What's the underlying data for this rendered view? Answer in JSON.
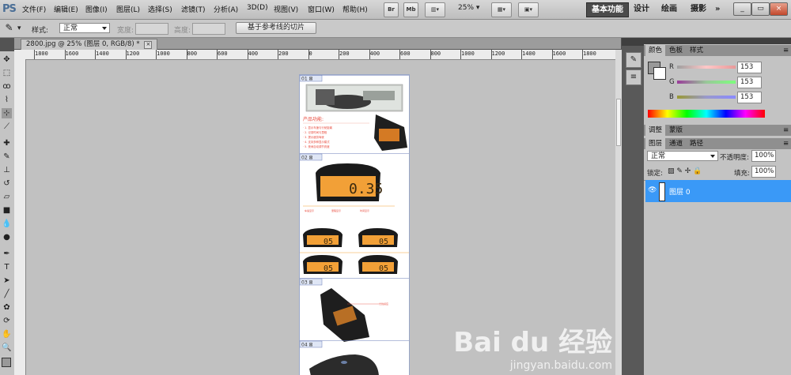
{
  "app": {
    "logo": "PS"
  },
  "menu": [
    "文件(F)",
    "编辑(E)",
    "图像(I)",
    "图层(L)",
    "选择(S)",
    "滤镜(T)",
    "分析(A)",
    "3D(D)",
    "视图(V)",
    "窗口(W)",
    "帮助(H)"
  ],
  "app_toolbar": {
    "br": "Br",
    "mb": "Mb",
    "zoom": "25%"
  },
  "workspaces": [
    "基本功能",
    "设计",
    "绘画",
    "摄影"
  ],
  "more": "»",
  "options": {
    "style_label": "样式:",
    "style_value": "正常",
    "width_label": "宽度:",
    "height_label": "高度:",
    "slice_button": "基于参考线的切片"
  },
  "document": {
    "tab_title": "2800.jpg @ 25% (图层 0, RGB/8) *",
    "close": "×"
  },
  "ruler_labels": [
    "1800",
    "1600",
    "1400",
    "1200",
    "1000",
    "800",
    "600",
    "400",
    "200",
    "0",
    "200",
    "400",
    "600",
    "800",
    "1000",
    "1200",
    "1400",
    "1600",
    "1800"
  ],
  "color_panel": {
    "tabs": [
      "颜色",
      "色板",
      "样式"
    ],
    "r_label": "R",
    "g_label": "G",
    "b_label": "B",
    "r": "153",
    "g": "153",
    "b": "153",
    "swatch": "#999999"
  },
  "adjust_tabs": [
    "调整",
    "蒙版"
  ],
  "layers_panel": {
    "tabs": [
      "图层",
      "通道",
      "路径"
    ],
    "blend_mode": "正常",
    "opacity_label": "不透明度:",
    "opacity": "100%",
    "lock_label": "锁定:",
    "fill_label": "填充:",
    "fill": "100%",
    "layer_name": "图层 0"
  },
  "colors": {
    "accent": "#3a99f7",
    "orange": "#f2a037"
  },
  "doc_content": {
    "heading": "产品功能:",
    "items": [
      "1. 显示车速与行驶距离",
      "2. 记录时间与里程",
      "3. 提示疲劳驾驶",
      "4. 支持多种显示模式"
    ],
    "displays": [
      "0.35",
      "05",
      "05",
      "05",
      "05"
    ]
  },
  "watermark": {
    "main": "Bai du 经验",
    "sub": "jingyan.baidu.com"
  }
}
